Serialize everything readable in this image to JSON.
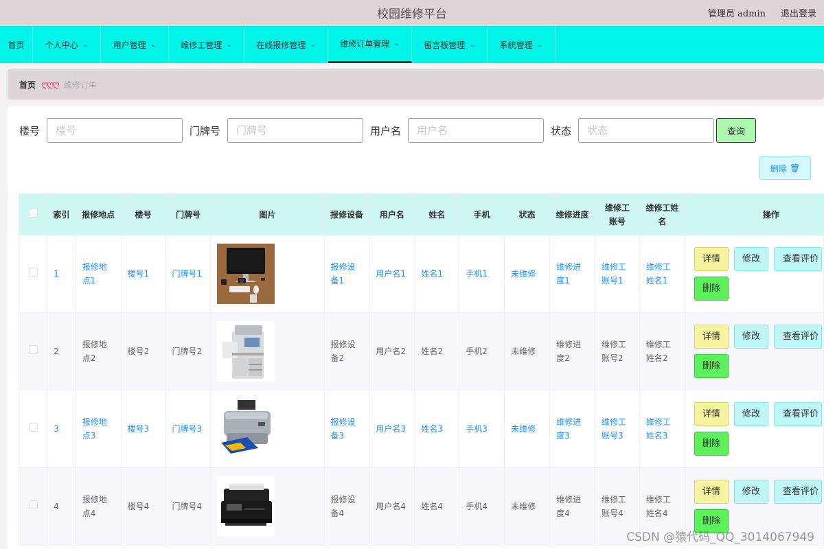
{
  "header": {
    "title": "校园维修平台",
    "user": "管理员 admin",
    "logout": "退出登录"
  },
  "nav": [
    {
      "label": "首页",
      "dropdown": false
    },
    {
      "label": "个人中心",
      "dropdown": true
    },
    {
      "label": "用户管理",
      "dropdown": true
    },
    {
      "label": "维修工管理",
      "dropdown": true
    },
    {
      "label": "在线报修管理",
      "dropdown": true
    },
    {
      "label": "维修订单管理",
      "dropdown": true,
      "active": true
    },
    {
      "label": "留言板管理",
      "dropdown": true
    },
    {
      "label": "系统管理",
      "dropdown": true
    }
  ],
  "breadcrumb": {
    "home": "首页",
    "separator": "ღღღ",
    "current": "维修订单"
  },
  "search": {
    "fields": [
      {
        "label": "楼号",
        "placeholder": "楼号"
      },
      {
        "label": "门牌号",
        "placeholder": "门牌号"
      },
      {
        "label": "用户名",
        "placeholder": "用户名"
      },
      {
        "label": "状态",
        "placeholder": "状态"
      }
    ],
    "query_label": "查询"
  },
  "toolbar": {
    "delete_label": "删除",
    "delete_icon": "trash-icon"
  },
  "table": {
    "columns": [
      "",
      "索引",
      "报修地点",
      "楼号",
      "门牌号",
      "图片",
      "报修设备",
      "用户名",
      "姓名",
      "手机",
      "状态",
      "维修进度",
      "维修工账号",
      "维修工姓名",
      "操作"
    ],
    "actions": {
      "detail": "详情",
      "edit": "修改",
      "view": "查看评价",
      "delete": "删除"
    },
    "rows": [
      {
        "index": "1",
        "location": "报修地点1",
        "building": "楼号1",
        "door": "门牌号1",
        "image": "desktop-computer",
        "device": "报修设备1",
        "username": "用户名1",
        "name": "姓名1",
        "phone": "手机1",
        "status": "未维修",
        "progress": "维修进度1",
        "worker_account": "维修工账号1",
        "worker_name": "维修工姓名1"
      },
      {
        "index": "2",
        "location": "报修地点2",
        "building": "楼号2",
        "door": "门牌号2",
        "image": "office-copier",
        "device": "报修设备2",
        "username": "用户名2",
        "name": "姓名2",
        "phone": "手机2",
        "status": "未维修",
        "progress": "维修进度2",
        "worker_account": "维修工账号2",
        "worker_name": "维修工姓名2"
      },
      {
        "index": "3",
        "location": "报修地点3",
        "building": "楼号3",
        "door": "门牌号3",
        "image": "inkjet-printer",
        "device": "报修设备3",
        "username": "用户名3",
        "name": "姓名3",
        "phone": "手机3",
        "status": "未维修",
        "progress": "维修进度3",
        "worker_account": "维修工账号3",
        "worker_name": "维修工姓名3"
      },
      {
        "index": "4",
        "location": "报修地点4",
        "building": "楼号4",
        "door": "门牌号4",
        "image": "laser-printer",
        "device": "报修设备4",
        "username": "用户名4",
        "name": "姓名4",
        "phone": "手机4",
        "status": "未维修",
        "progress": "维修进度4",
        "worker_account": "维修工账号4",
        "worker_name": "维修工姓名4"
      }
    ]
  },
  "watermark": "CSDN @猿代码_QQ_3014067949"
}
